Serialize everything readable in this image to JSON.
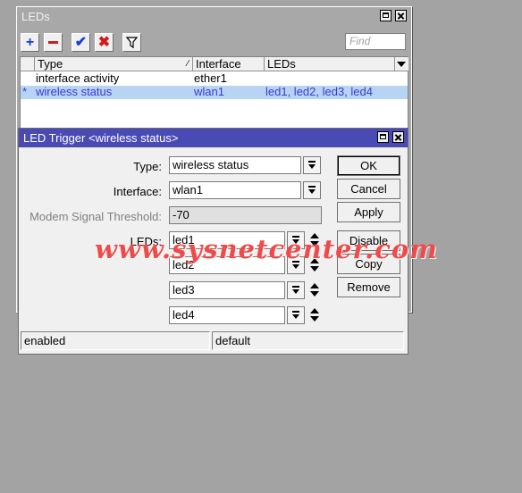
{
  "leds_window": {
    "title": "LEDs",
    "find_placeholder": "Find",
    "columns": [
      "Type",
      "Interface",
      "LEDs"
    ],
    "rows": [
      {
        "marker": "",
        "type": "interface activity",
        "interface": "ether1",
        "leds": ""
      },
      {
        "marker": "*",
        "type": "wireless status",
        "interface": "wlan1",
        "leds": "led1, led2, led3, led4"
      }
    ],
    "toolbar_icons": [
      "add-icon",
      "remove-icon",
      "enable-icon",
      "disable-icon",
      "filter-icon"
    ]
  },
  "dialog": {
    "title": "LED Trigger <wireless status>",
    "type_label": "Type:",
    "type_value": "wireless status",
    "interface_label": "Interface:",
    "interface_value": "wlan1",
    "modem_label": "Modem Signal Threshold:",
    "modem_value": "-70",
    "leds_label": "LEDs:",
    "leds": [
      "led1",
      "led2",
      "led3",
      "led4"
    ],
    "buttons": {
      "ok": "OK",
      "cancel": "Cancel",
      "apply": "Apply",
      "disable": "Disable",
      "copy": "Copy",
      "remove": "Remove"
    },
    "status_left": "enabled",
    "status_right": "default"
  },
  "watermark": "www.sysnetcenter.com",
  "colors": {
    "dialog_title_bg": "#4a4ab5",
    "selected_row_bg": "#b8d4f4",
    "selected_row_text": "#3a3ad0",
    "watermark": "#f04a4a"
  }
}
